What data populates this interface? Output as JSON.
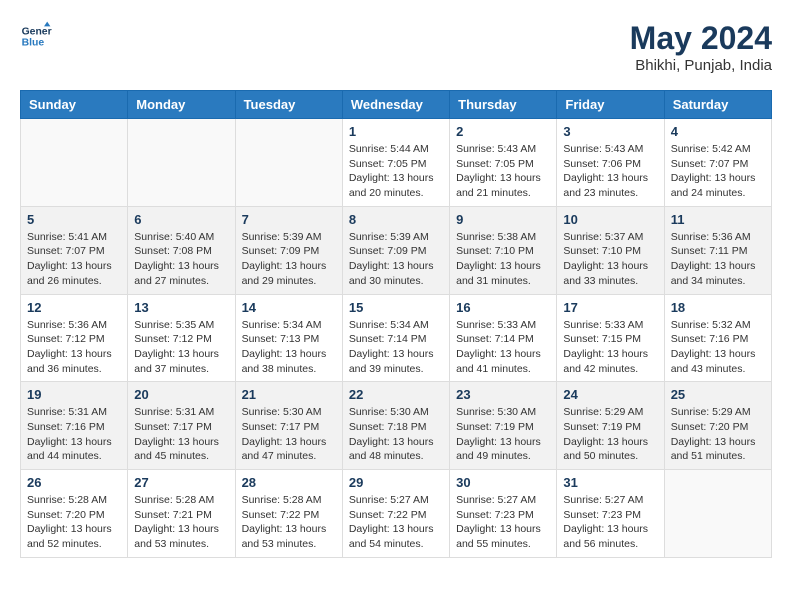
{
  "header": {
    "logo_line1": "General",
    "logo_line2": "Blue",
    "month_year": "May 2024",
    "location": "Bhikhi, Punjab, India"
  },
  "weekdays": [
    "Sunday",
    "Monday",
    "Tuesday",
    "Wednesday",
    "Thursday",
    "Friday",
    "Saturday"
  ],
  "weeks": [
    [
      {
        "day": "",
        "info": ""
      },
      {
        "day": "",
        "info": ""
      },
      {
        "day": "",
        "info": ""
      },
      {
        "day": "1",
        "info": "Sunrise: 5:44 AM\nSunset: 7:05 PM\nDaylight: 13 hours\nand 20 minutes."
      },
      {
        "day": "2",
        "info": "Sunrise: 5:43 AM\nSunset: 7:05 PM\nDaylight: 13 hours\nand 21 minutes."
      },
      {
        "day": "3",
        "info": "Sunrise: 5:43 AM\nSunset: 7:06 PM\nDaylight: 13 hours\nand 23 minutes."
      },
      {
        "day": "4",
        "info": "Sunrise: 5:42 AM\nSunset: 7:07 PM\nDaylight: 13 hours\nand 24 minutes."
      }
    ],
    [
      {
        "day": "5",
        "info": "Sunrise: 5:41 AM\nSunset: 7:07 PM\nDaylight: 13 hours\nand 26 minutes."
      },
      {
        "day": "6",
        "info": "Sunrise: 5:40 AM\nSunset: 7:08 PM\nDaylight: 13 hours\nand 27 minutes."
      },
      {
        "day": "7",
        "info": "Sunrise: 5:39 AM\nSunset: 7:09 PM\nDaylight: 13 hours\nand 29 minutes."
      },
      {
        "day": "8",
        "info": "Sunrise: 5:39 AM\nSunset: 7:09 PM\nDaylight: 13 hours\nand 30 minutes."
      },
      {
        "day": "9",
        "info": "Sunrise: 5:38 AM\nSunset: 7:10 PM\nDaylight: 13 hours\nand 31 minutes."
      },
      {
        "day": "10",
        "info": "Sunrise: 5:37 AM\nSunset: 7:10 PM\nDaylight: 13 hours\nand 33 minutes."
      },
      {
        "day": "11",
        "info": "Sunrise: 5:36 AM\nSunset: 7:11 PM\nDaylight: 13 hours\nand 34 minutes."
      }
    ],
    [
      {
        "day": "12",
        "info": "Sunrise: 5:36 AM\nSunset: 7:12 PM\nDaylight: 13 hours\nand 36 minutes."
      },
      {
        "day": "13",
        "info": "Sunrise: 5:35 AM\nSunset: 7:12 PM\nDaylight: 13 hours\nand 37 minutes."
      },
      {
        "day": "14",
        "info": "Sunrise: 5:34 AM\nSunset: 7:13 PM\nDaylight: 13 hours\nand 38 minutes."
      },
      {
        "day": "15",
        "info": "Sunrise: 5:34 AM\nSunset: 7:14 PM\nDaylight: 13 hours\nand 39 minutes."
      },
      {
        "day": "16",
        "info": "Sunrise: 5:33 AM\nSunset: 7:14 PM\nDaylight: 13 hours\nand 41 minutes."
      },
      {
        "day": "17",
        "info": "Sunrise: 5:33 AM\nSunset: 7:15 PM\nDaylight: 13 hours\nand 42 minutes."
      },
      {
        "day": "18",
        "info": "Sunrise: 5:32 AM\nSunset: 7:16 PM\nDaylight: 13 hours\nand 43 minutes."
      }
    ],
    [
      {
        "day": "19",
        "info": "Sunrise: 5:31 AM\nSunset: 7:16 PM\nDaylight: 13 hours\nand 44 minutes."
      },
      {
        "day": "20",
        "info": "Sunrise: 5:31 AM\nSunset: 7:17 PM\nDaylight: 13 hours\nand 45 minutes."
      },
      {
        "day": "21",
        "info": "Sunrise: 5:30 AM\nSunset: 7:17 PM\nDaylight: 13 hours\nand 47 minutes."
      },
      {
        "day": "22",
        "info": "Sunrise: 5:30 AM\nSunset: 7:18 PM\nDaylight: 13 hours\nand 48 minutes."
      },
      {
        "day": "23",
        "info": "Sunrise: 5:30 AM\nSunset: 7:19 PM\nDaylight: 13 hours\nand 49 minutes."
      },
      {
        "day": "24",
        "info": "Sunrise: 5:29 AM\nSunset: 7:19 PM\nDaylight: 13 hours\nand 50 minutes."
      },
      {
        "day": "25",
        "info": "Sunrise: 5:29 AM\nSunset: 7:20 PM\nDaylight: 13 hours\nand 51 minutes."
      }
    ],
    [
      {
        "day": "26",
        "info": "Sunrise: 5:28 AM\nSunset: 7:20 PM\nDaylight: 13 hours\nand 52 minutes."
      },
      {
        "day": "27",
        "info": "Sunrise: 5:28 AM\nSunset: 7:21 PM\nDaylight: 13 hours\nand 53 minutes."
      },
      {
        "day": "28",
        "info": "Sunrise: 5:28 AM\nSunset: 7:22 PM\nDaylight: 13 hours\nand 53 minutes."
      },
      {
        "day": "29",
        "info": "Sunrise: 5:27 AM\nSunset: 7:22 PM\nDaylight: 13 hours\nand 54 minutes."
      },
      {
        "day": "30",
        "info": "Sunrise: 5:27 AM\nSunset: 7:23 PM\nDaylight: 13 hours\nand 55 minutes."
      },
      {
        "day": "31",
        "info": "Sunrise: 5:27 AM\nSunset: 7:23 PM\nDaylight: 13 hours\nand 56 minutes."
      },
      {
        "day": "",
        "info": ""
      }
    ]
  ]
}
